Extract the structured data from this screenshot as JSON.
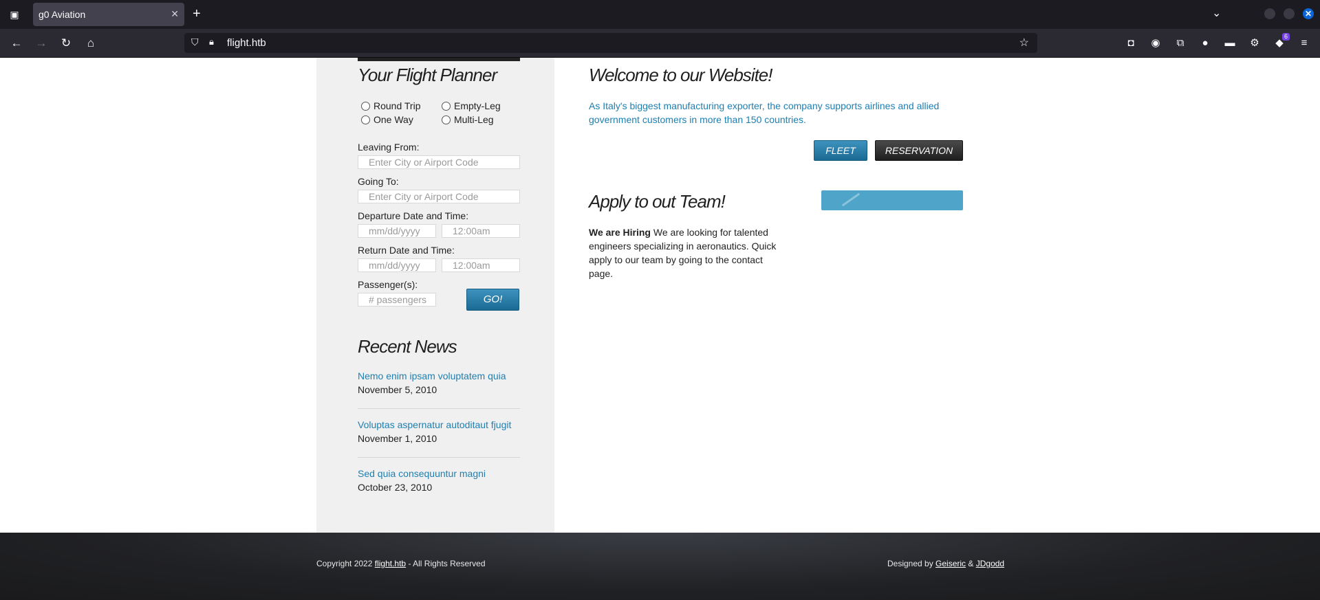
{
  "browser": {
    "tab_title": "g0 Aviation",
    "url": "flight.htb",
    "new_tab": "+",
    "extension_badge": "6"
  },
  "sidebar": {
    "planner_title": "Your Flight Planner",
    "trip_types": {
      "round_trip": "Round Trip",
      "empty_leg": "Empty-Leg",
      "one_way": "One Way",
      "multi_leg": "Multi-Leg"
    },
    "leaving_label": "Leaving From:",
    "leaving_placeholder": "Enter City or Airport Code",
    "going_label": "Going To:",
    "going_placeholder": "Enter City or Airport Code",
    "departure_label": "Departure Date and Time:",
    "date_placeholder": "mm/dd/yyyy",
    "time_placeholder": "12:00am",
    "return_label": "Return Date and Time:",
    "passengers_label": "Passenger(s):",
    "passengers_placeholder": "# passengers",
    "go_label": "GO!",
    "news_title": "Recent News",
    "news": [
      {
        "title": "Nemo enim ipsam voluptatem quia",
        "date": "November 5, 2010"
      },
      {
        "title": "Voluptas aspernatur autoditaut fjugit",
        "date": "November 1, 2010"
      },
      {
        "title": "Sed quia consequuntur magni",
        "date": "October 23, 2010"
      }
    ]
  },
  "main": {
    "welcome_title": "Welcome to our Website!",
    "welcome_text": "As Italy's biggest manufacturing exporter, the company supports airlines and allied government customers in more than 150 countries.",
    "fleet_label": "FLEET",
    "reservation_label": "RESERVATION",
    "team_title": "Apply to out Team!",
    "hiring_bold": "We are Hiring",
    "hiring_text": " We are looking for talented engineers specializing in aeronautics. Quick apply to our team by going to the contact page."
  },
  "footer": {
    "copyright_prefix": "Copyright 2022 ",
    "copyright_link": "flight.htb",
    "copyright_suffix": " - All Rights Reserved",
    "designed_prefix": "Designed by ",
    "designer1": "Geiseric",
    "amp": " & ",
    "designer2": "JDgodd"
  }
}
